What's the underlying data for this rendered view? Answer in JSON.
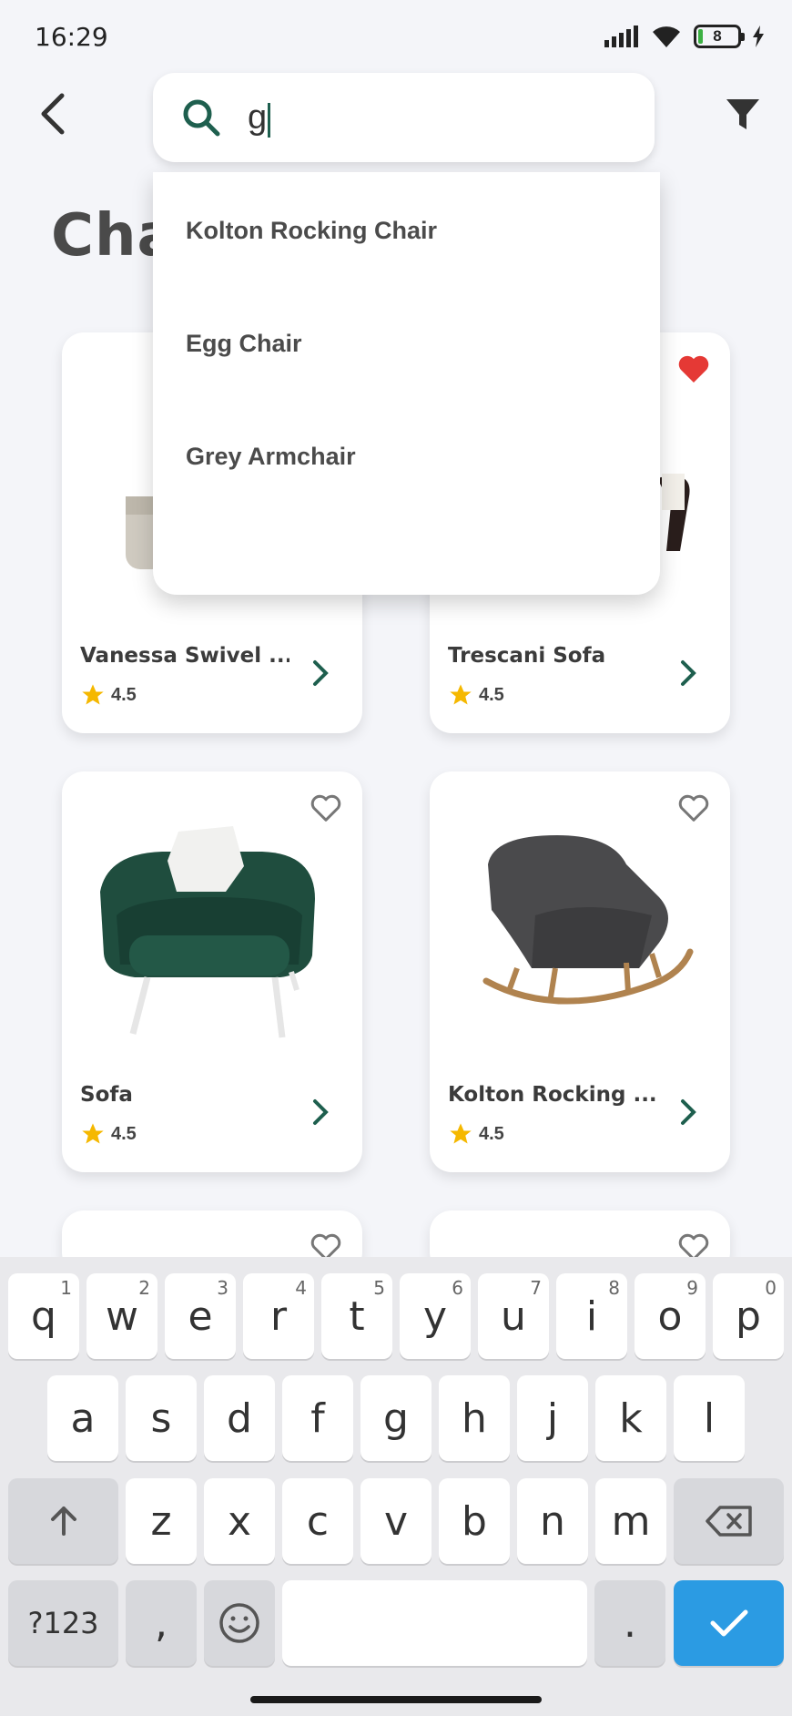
{
  "status_bar": {
    "time": "16:29",
    "battery_level": "8",
    "icons": [
      "signal-icon",
      "wifi-icon",
      "battery-icon",
      "charging-icon"
    ]
  },
  "header": {
    "search_value": "g",
    "page_title": "Cha",
    "icons": {
      "back": "back-arrow-icon",
      "search": "search-icon",
      "filter": "filter-icon"
    }
  },
  "suggestions": [
    {
      "label": "Kolton Rocking Chair"
    },
    {
      "label": "Egg Chair"
    },
    {
      "label": "Grey Armchair"
    }
  ],
  "products": [
    {
      "name": "Vanessa Swivel ...",
      "rating": "4.5",
      "favorited": false
    },
    {
      "name": "Trescani Sofa",
      "rating": "4.5",
      "favorited": true
    },
    {
      "name": "Sofa",
      "rating": "4.5",
      "favorited": false
    },
    {
      "name": "Kolton Rocking ...",
      "rating": "4.5",
      "favorited": false
    }
  ],
  "keyboard": {
    "row1": [
      {
        "k": "q",
        "h": "1"
      },
      {
        "k": "w",
        "h": "2"
      },
      {
        "k": "e",
        "h": "3"
      },
      {
        "k": "r",
        "h": "4"
      },
      {
        "k": "t",
        "h": "5"
      },
      {
        "k": "y",
        "h": "6"
      },
      {
        "k": "u",
        "h": "7"
      },
      {
        "k": "i",
        "h": "8"
      },
      {
        "k": "o",
        "h": "9"
      },
      {
        "k": "p",
        "h": "0"
      }
    ],
    "row2": [
      "a",
      "s",
      "d",
      "f",
      "g",
      "h",
      "j",
      "k",
      "l"
    ],
    "row3": [
      "z",
      "x",
      "c",
      "v",
      "b",
      "n",
      "m"
    ],
    "symbols_label": "?123",
    "comma": ",",
    "period": "."
  },
  "colors": {
    "accent": "#1e5f4e",
    "heart_active": "#e53935",
    "star": "#f5b800",
    "keyboard_done": "#2b9be3"
  }
}
